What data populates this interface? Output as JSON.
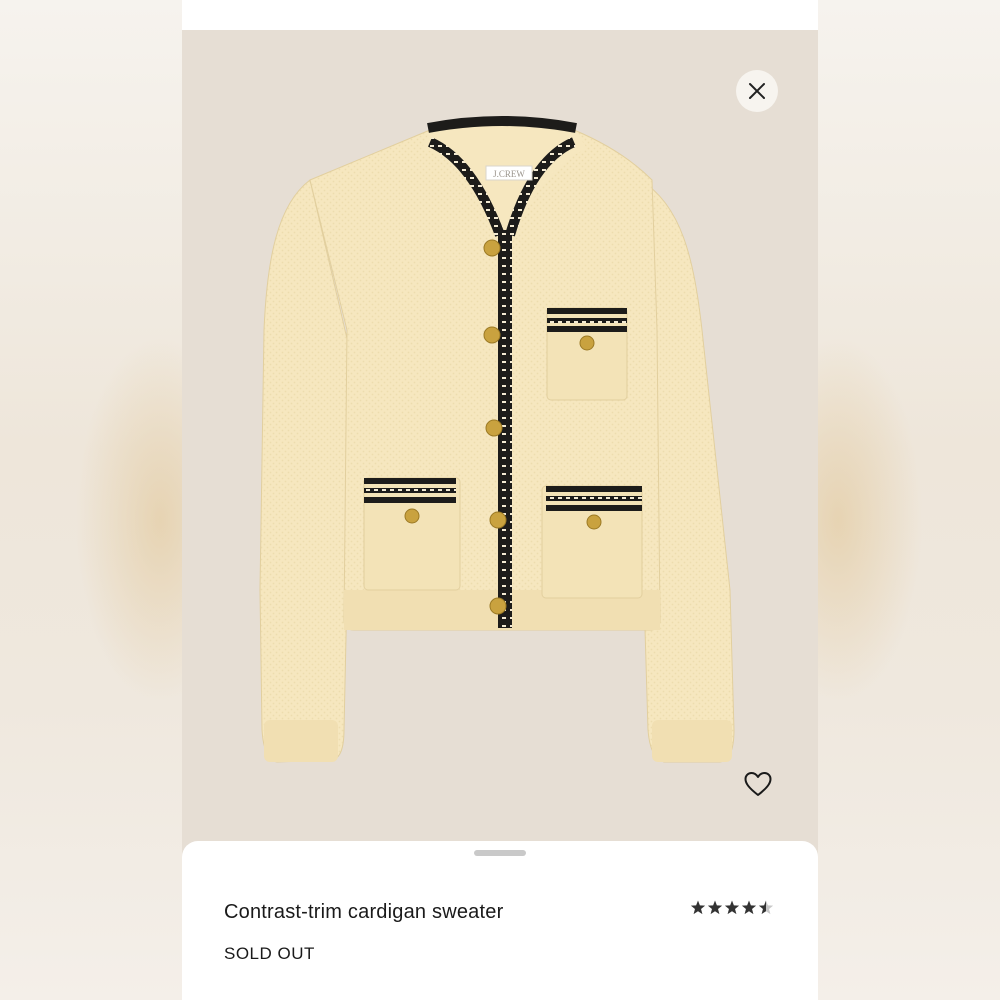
{
  "product": {
    "title": "Contrast-trim cardigan sweater",
    "stock_status": "SOLD OUT",
    "brand_label": "J.CREW",
    "rating_stars": 4.5,
    "rating_max": 5
  },
  "icons": {
    "close": "close-icon",
    "favorite": "heart-outline-icon",
    "star": "star-icon"
  },
  "colors": {
    "sheet_bg": "#ffffff",
    "image_bg": "#e6ded4",
    "sweater": "#f6e7bf",
    "trim": "#1d1c1a",
    "buttons": "#c9a23f",
    "text": "#1a1a1a"
  }
}
